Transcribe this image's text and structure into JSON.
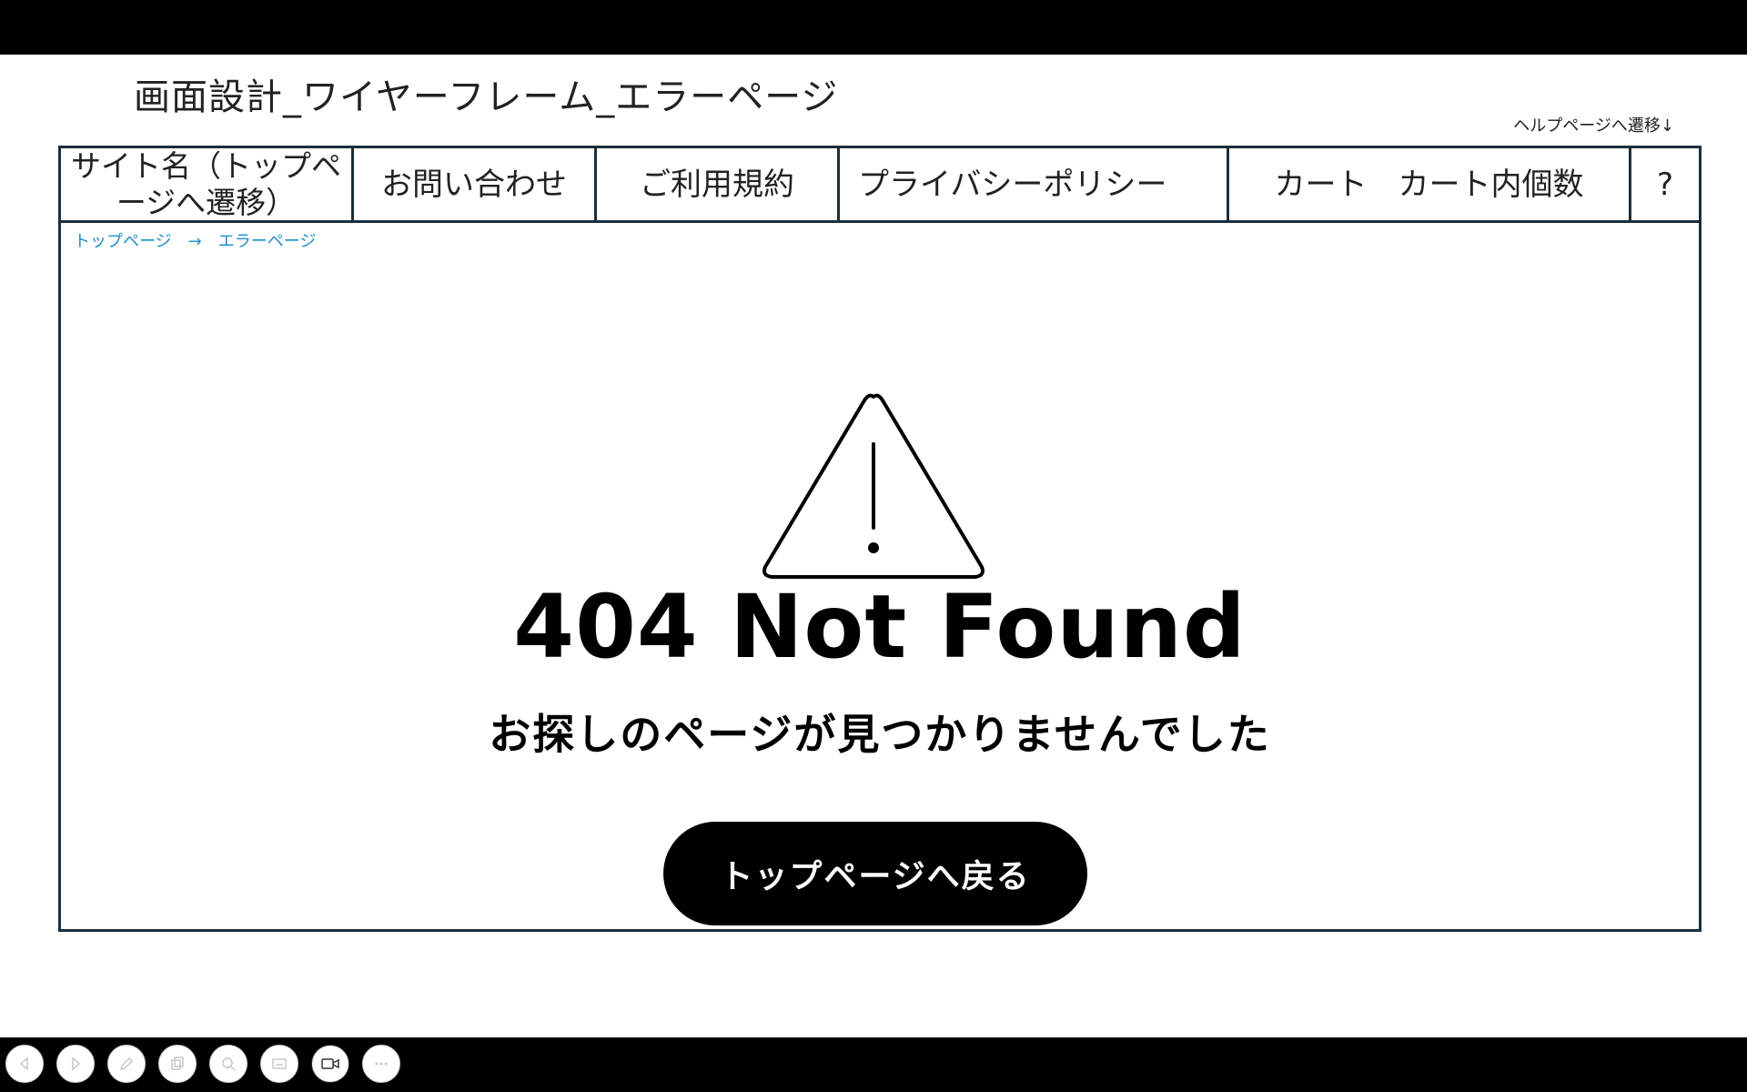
{
  "slide": {
    "title": "画面設計_ワイヤーフレーム_エラーページ",
    "help_link": "ヘルプページへ遷移↓"
  },
  "nav": {
    "site_name": "サイト名（トップページへ遷移）",
    "contact": "お問い合わせ",
    "terms": "ご利用規約",
    "privacy": "プライバシーポリシー",
    "cart": "カート　カート内個数",
    "help": "?"
  },
  "breadcrumb": {
    "home": "トップページ",
    "arrow": "→",
    "current": "エラーページ"
  },
  "error": {
    "code": "404 Not Found",
    "message": "お探しのページが見つかりませんでした",
    "back_button": "トップページへ戻る"
  },
  "toolbar": {
    "items": [
      "previous-icon",
      "next-icon",
      "pen-icon",
      "copy-icon",
      "zoom-icon",
      "subtitles-icon",
      "camera-icon",
      "more-icon"
    ]
  }
}
